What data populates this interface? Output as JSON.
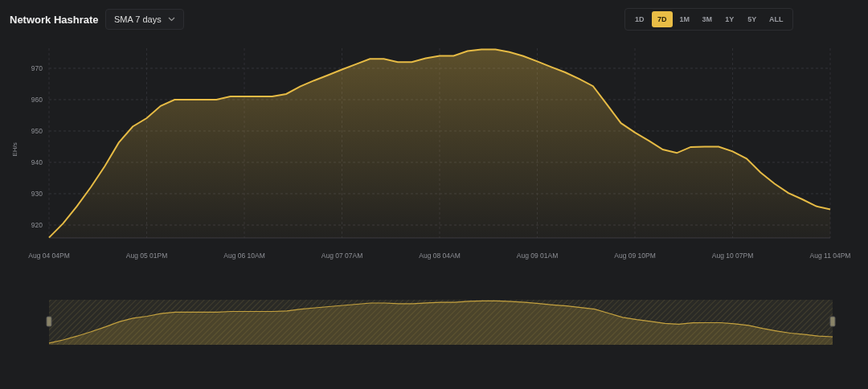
{
  "header": {
    "title": "Network Hashrate",
    "average_dropdown": {
      "value": "SMA 7 days"
    }
  },
  "ranges": [
    {
      "label": "1D",
      "selected": false
    },
    {
      "label": "7D",
      "selected": true
    },
    {
      "label": "1M",
      "selected": false
    },
    {
      "label": "3M",
      "selected": false
    },
    {
      "label": "1Y",
      "selected": false
    },
    {
      "label": "5Y",
      "selected": false
    },
    {
      "label": "ALL",
      "selected": false
    }
  ],
  "chart": {
    "chart_data": {
      "type": "area",
      "ylabel": "EH/s",
      "categories": [
        "Aug 04 04PM",
        null,
        null,
        null,
        null,
        null,
        null,
        "Aug 05 01PM",
        null,
        null,
        null,
        null,
        null,
        null,
        "Aug 06 10AM",
        null,
        null,
        null,
        null,
        null,
        null,
        "Aug 07 07AM",
        null,
        null,
        null,
        null,
        null,
        null,
        "Aug 08 04AM",
        null,
        null,
        null,
        null,
        null,
        null,
        "Aug 09 01AM",
        null,
        null,
        null,
        null,
        null,
        null,
        "Aug 09 10PM",
        null,
        null,
        null,
        null,
        null,
        null,
        "Aug 10 07PM",
        null,
        null,
        null,
        null,
        null,
        null,
        "Aug 11 04PM"
      ],
      "series": [
        {
          "color": "#e6bb45",
          "values": [
            916,
            920.5,
            926,
            932.1,
            938.8,
            946.3,
            951.4,
            954.1,
            958,
            960,
            960,
            960,
            960,
            961,
            961,
            961,
            961,
            961.8,
            964.2,
            966.1,
            967.8,
            969.6,
            971.3,
            973,
            973,
            972,
            972,
            973.2,
            974,
            974,
            975.5,
            976,
            976,
            975.2,
            973.9,
            972.2,
            970.4,
            968.7,
            966.6,
            964.3,
            958.4,
            952.5,
            949.5,
            946.9,
            944.1,
            943,
            944.9,
            945,
            945,
            943.5,
            941.2,
            936.8,
            933.2,
            930.2,
            928.2,
            926,
            925
          ]
        }
      ],
      "ylim": [
        915.9,
        976.4
      ],
      "grid": true,
      "yticks": [
        920,
        930,
        940,
        950,
        960,
        970
      ]
    }
  }
}
